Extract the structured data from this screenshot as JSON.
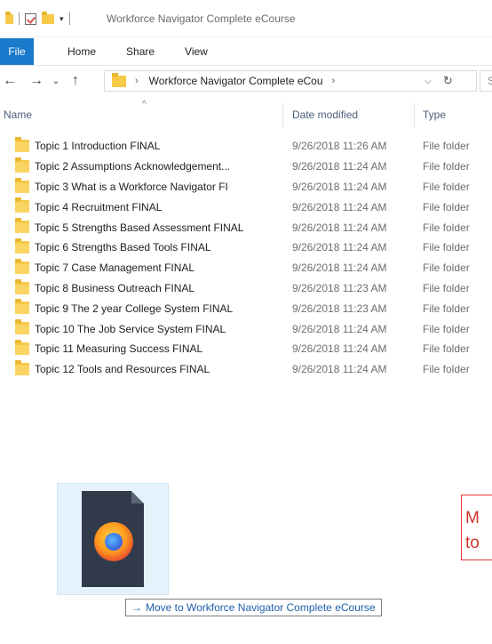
{
  "window": {
    "title": "Workforce Navigator Complete eCourse"
  },
  "ribbon": {
    "tabs": [
      "File",
      "Home",
      "Share",
      "View"
    ]
  },
  "address_bar": {
    "path_text": "Workforce Navigator Complete eCou",
    "search_placeholder": "S"
  },
  "columns": {
    "name": "Name",
    "date_modified": "Date modified",
    "type": "Type"
  },
  "files": [
    {
      "name": "Topic 1 Introduction FINAL",
      "date": "9/26/2018 11:26 AM",
      "type": "File folder"
    },
    {
      "name": "Topic 2 Assumptions Acknowledgement...",
      "date": "9/26/2018 11:24 AM",
      "type": "File folder"
    },
    {
      "name": "Topic 3 What is a Workforce Navigator FI",
      "date": "9/26/2018 11:24 AM",
      "type": "File folder"
    },
    {
      "name": "Topic 4 Recruitment FINAL",
      "date": "9/26/2018 11:24 AM",
      "type": "File folder"
    },
    {
      "name": "Topic 5 Strengths Based Assessment FINAL",
      "date": "9/26/2018 11:24 AM",
      "type": "File folder"
    },
    {
      "name": "Topic 6 Strengths Based Tools FINAL",
      "date": "9/26/2018 11:24 AM",
      "type": "File folder"
    },
    {
      "name": "Topic 7 Case Management FINAL",
      "date": "9/26/2018 11:24 AM",
      "type": "File folder"
    },
    {
      "name": "Topic 8 Business Outreach FINAL",
      "date": "9/26/2018 11:23 AM",
      "type": "File folder"
    },
    {
      "name": "Topic 9 The 2 year College System FINAL",
      "date": "9/26/2018 11:23 AM",
      "type": "File folder"
    },
    {
      "name": "Topic 10 The Job Service System FINAL",
      "date": "9/26/2018 11:24 AM",
      "type": "File folder"
    },
    {
      "name": "Topic 11 Measuring Success FINAL",
      "date": "9/26/2018 11:24 AM",
      "type": "File folder"
    },
    {
      "name": "Topic 12 Tools and Resources FINAL",
      "date": "9/26/2018 11:24 AM",
      "type": "File folder"
    }
  ],
  "drag": {
    "tooltip": "Move to Workforce Navigator Complete eCourse",
    "icon": "firefox-document-icon"
  },
  "callout": {
    "line1": "M",
    "line2": "to"
  },
  "colors": {
    "file_tab": "#1979ca",
    "folder": "#f7c948",
    "drag_highlight": "#e6f2fb",
    "callout_border": "#e03a3a"
  }
}
